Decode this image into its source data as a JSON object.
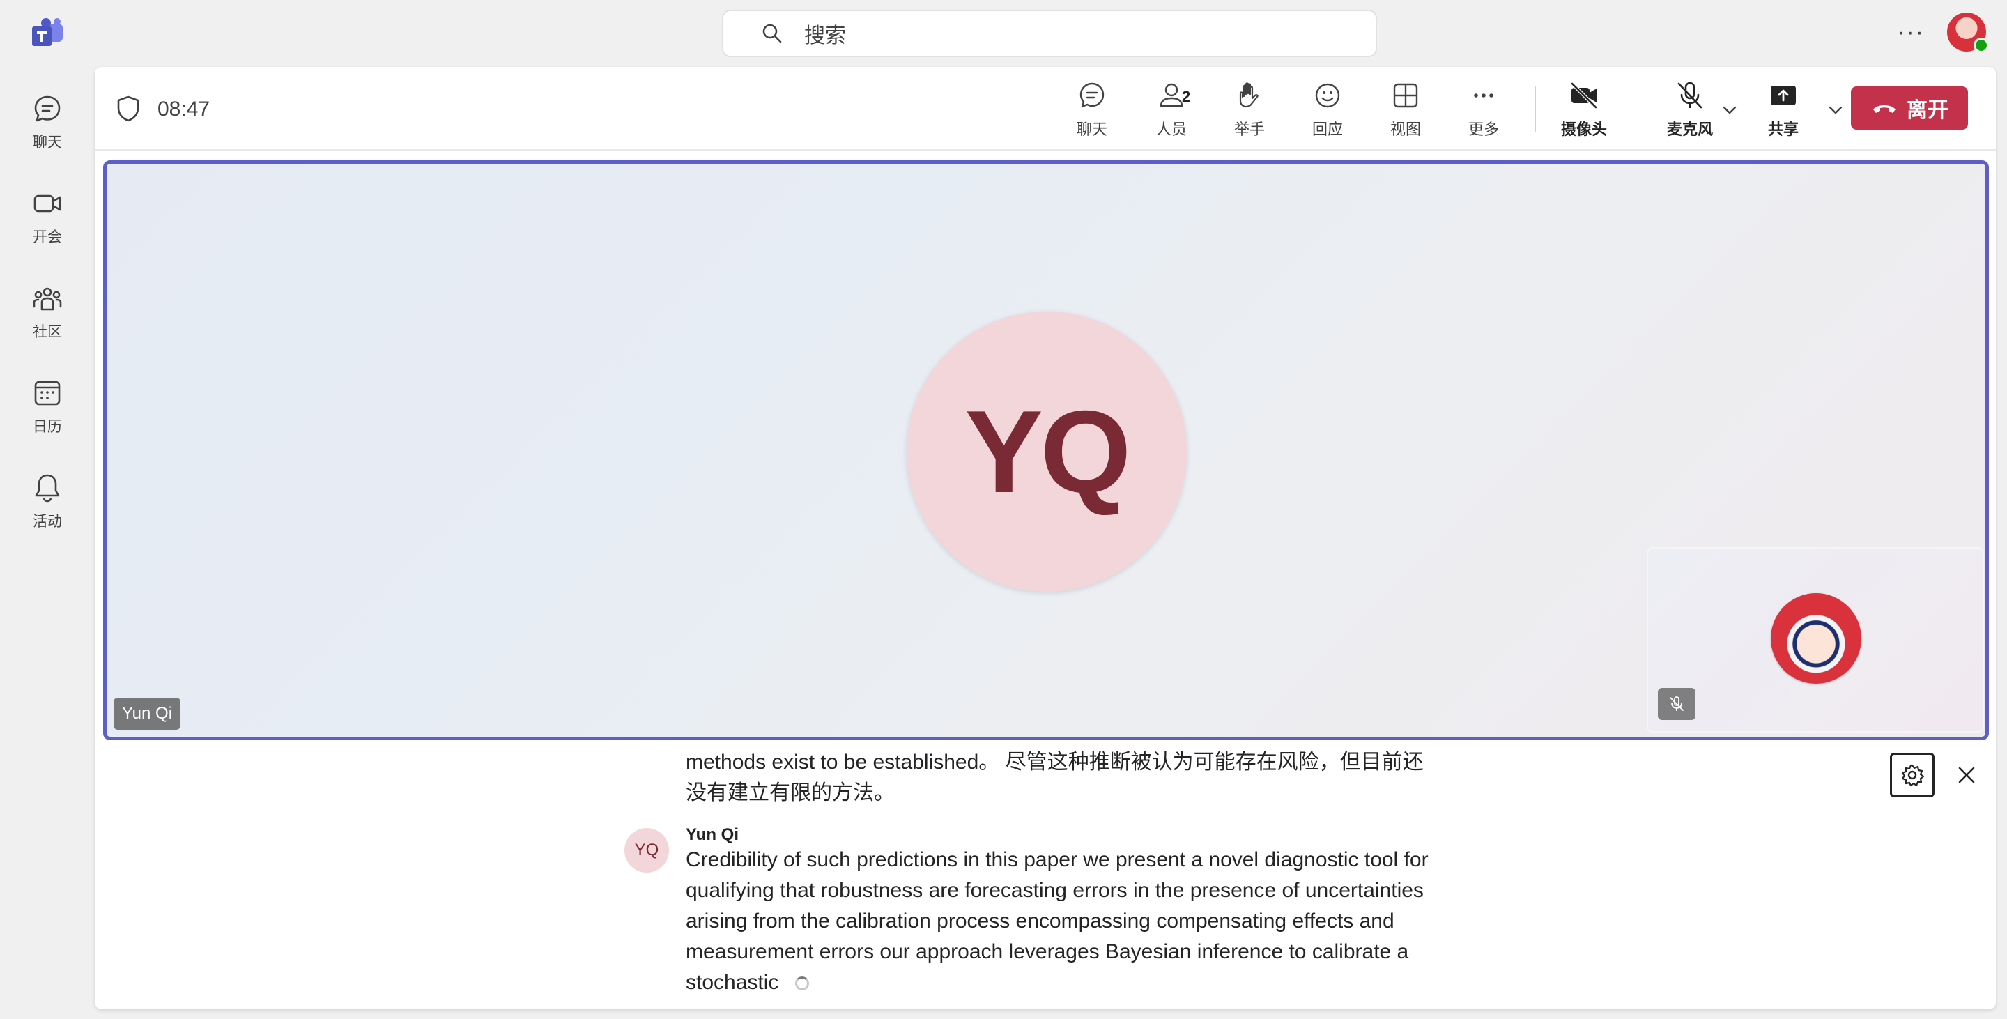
{
  "topbar": {
    "app_icon": "teams-logo-icon",
    "search_placeholder": "搜索",
    "more_icon": "more-horizontal-icon",
    "more_glyph": "···",
    "avatar": "user-avatar",
    "presence": "available"
  },
  "rail": {
    "items": [
      {
        "label": "聊天",
        "icon": "chat-icon"
      },
      {
        "label": "开会",
        "icon": "video-meeting-icon"
      },
      {
        "label": "社区",
        "icon": "community-icon"
      },
      {
        "label": "日历",
        "icon": "calendar-icon"
      },
      {
        "label": "活动",
        "icon": "bell-icon"
      }
    ]
  },
  "meeting": {
    "timer": "08:47",
    "controls": {
      "chat": "聊天",
      "people": "人员",
      "people_count": "2",
      "raise_hand": "举手",
      "react": "回应",
      "view": "视图",
      "more": "更多",
      "camera": "摄像头",
      "mic": "麦克风",
      "share": "共享",
      "leave": "离开"
    },
    "stage": {
      "participant_initials": "YQ",
      "participant_name": "Yun Qi",
      "self_muted": true
    }
  },
  "captions": {
    "previous": "methods exist to be established。 尽管这种推断被认为可能存在风险，但目前还没有建立有限的方法。",
    "speaker_initials": "YQ",
    "speaker": "Yun Qi",
    "text": "Credibility of such predictions in this paper we present a novel diagnostic tool for qualifying that robustness are forecasting errors in the presence of uncertainties arising from the calibration process encompassing compensating effects and measurement errors our approach leverages Bayesian inference to calibrate a stochastic"
  },
  "colors": {
    "accent": "#5b5fc7",
    "leave": "#c4314b",
    "avatar_bg": "#f3d6d9",
    "avatar_text": "#7a2a35"
  }
}
